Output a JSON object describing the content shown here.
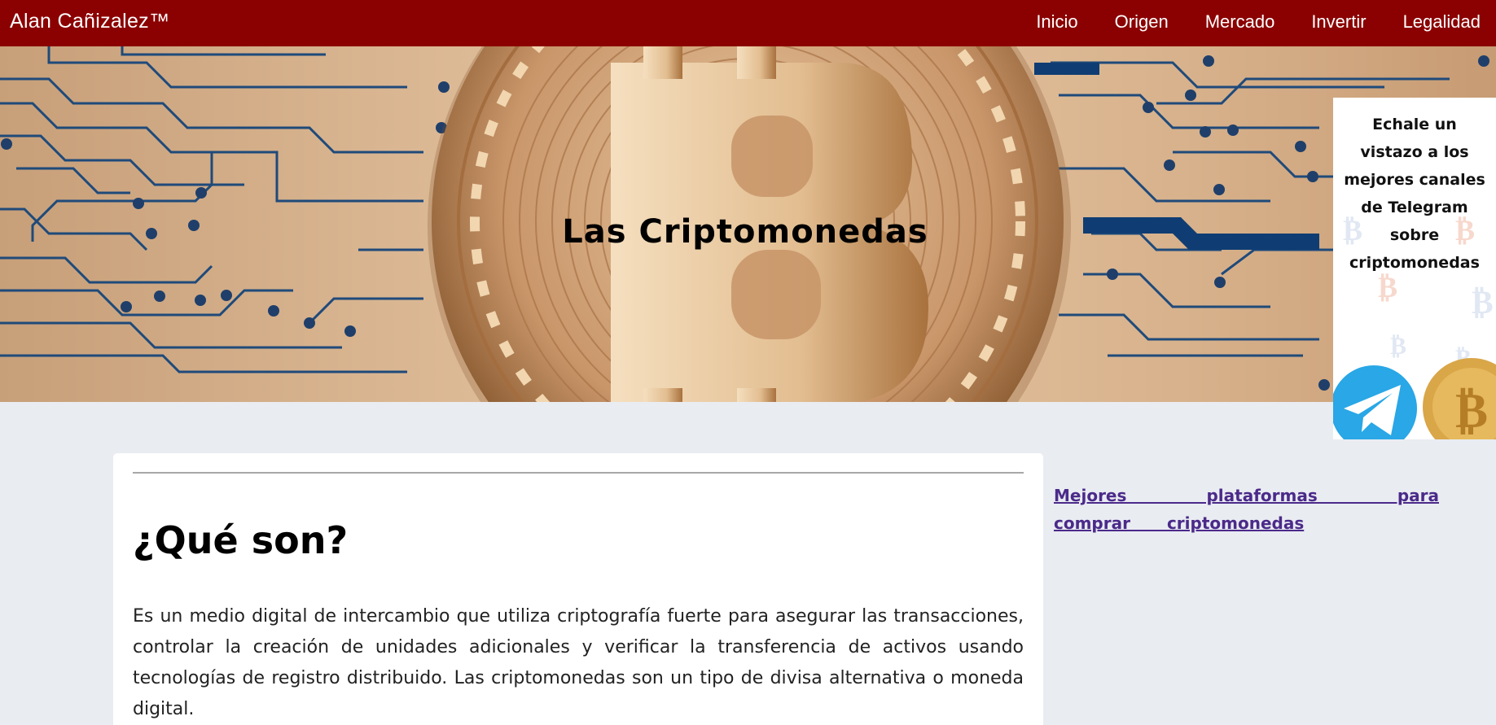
{
  "header": {
    "brand": "Alan Cañizalez™",
    "nav": [
      "Inicio",
      "Origen",
      "Mercado",
      "Invertir",
      "Legalidad"
    ]
  },
  "hero": {
    "title": "Las Criptomonedas"
  },
  "ad": {
    "text": "Echale un vistazo a los mejores canales de Telegram sobre criptomonedas"
  },
  "article": {
    "heading": "¿Qué son?",
    "paragraph": "Es un medio digital de intercambio que utiliza criptografía fuerte para asegurar las transacciones, controlar la creación de unidades adicionales y verificar la transferencia de activos usando tecnologías de registro distribuido. Las criptomonedas son un tipo de divisa alternativa o moneda digital."
  },
  "sidebar": {
    "link": "Mejores plataformas para comprar criptomonedas"
  },
  "colors": {
    "nav_bg": "#8b0000",
    "page_bg": "#e9ecf1",
    "link": "#4b2a8a",
    "circuit": "#1f4a7a"
  },
  "icons": [
    "bitcoin-coin-image",
    "telegram-icon",
    "bitcoin-icon"
  ]
}
